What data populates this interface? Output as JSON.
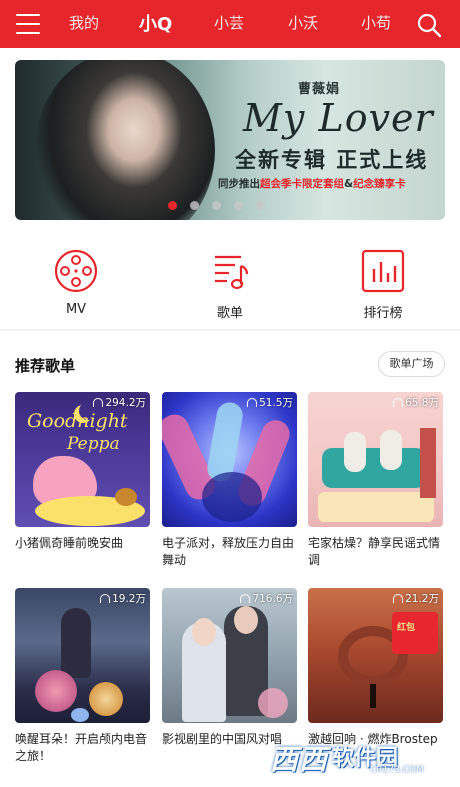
{
  "header": {
    "tabs": [
      {
        "label": "我的"
      },
      {
        "label": "小Q",
        "active": true
      },
      {
        "label": "小芸"
      },
      {
        "label": "小沃"
      },
      {
        "label": "小苟"
      }
    ],
    "brand_color": "#e6262b",
    "menu_icon": "hamburger-menu-icon",
    "search_icon": "search-icon"
  },
  "banner": {
    "singer": "曹薇娟",
    "album": "My Lover",
    "headline": "全新专辑 正式上线",
    "sub_prefix": "同步推出",
    "sub_highlight_1": "超会季卡限定套组",
    "sub_amp": "&",
    "sub_highlight_2": "纪念臻享卡",
    "dot_count": 5,
    "active_dot": 0
  },
  "quick": {
    "items": [
      {
        "label": "MV",
        "icon": "film-reel-icon"
      },
      {
        "label": "歌单",
        "icon": "playlist-icon"
      },
      {
        "label": "排行榜",
        "icon": "chart-icon"
      }
    ]
  },
  "playlists": {
    "title": "推荐歌单",
    "more_label": "歌单广场",
    "items": [
      {
        "plays": "294.2万",
        "name": "小猪佩奇睡前晚安曲"
      },
      {
        "plays": "51.5万",
        "name": "电子派对，释放压力自由舞动"
      },
      {
        "plays": "65.8万",
        "name": "宅家枯燥？静享民谣式情调"
      },
      {
        "plays": "19.2万",
        "name": "唤醒耳朵！开启颅内电音之旅！"
      },
      {
        "plays": "716.6万",
        "name": "影视剧里的中国风对唱"
      },
      {
        "plays": "21.2万",
        "name": "激越回响 · 燃炸Brostep"
      }
    ]
  },
  "watermark": {
    "brand": "西西",
    "text": "软件园",
    "url": "CR173.COM"
  }
}
